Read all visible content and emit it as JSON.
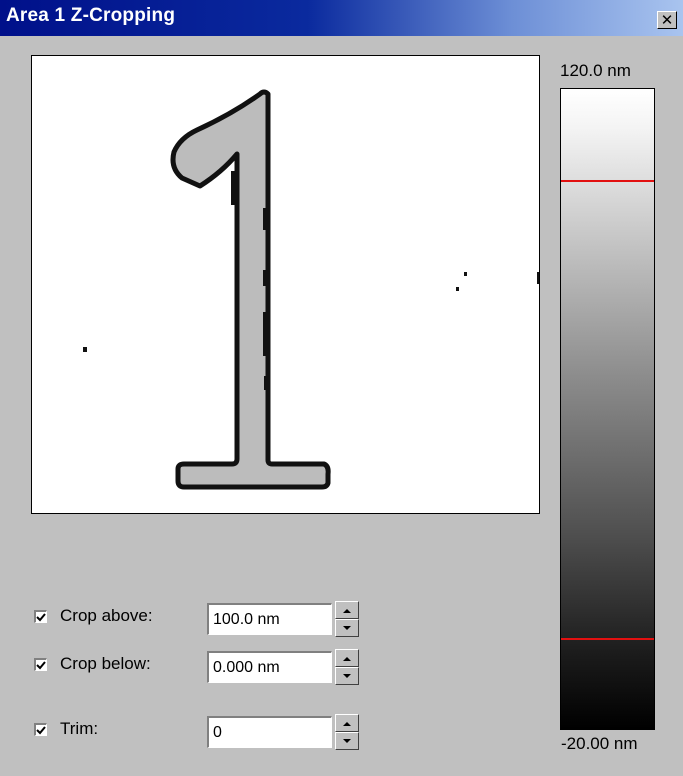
{
  "window": {
    "title": "Area 1 Z-Cropping",
    "close_glyph": "✕",
    "close_icon": "close-icon"
  },
  "colorbar": {
    "max_label": "120.0 nm",
    "min_label": "-20.00 nm",
    "range_nm": [
      -20.0,
      120.0
    ],
    "limit_line_color": "#e21010"
  },
  "controls": {
    "crop_above": {
      "label": "Crop above:",
      "checked": true,
      "value": "100.0 nm",
      "value_nm": 100.0
    },
    "crop_below": {
      "label": "Crop below:",
      "checked": true,
      "value": "0.000 nm",
      "value_nm": 0.0
    },
    "trim": {
      "label": "Trim:",
      "checked": true,
      "value": "0"
    }
  }
}
